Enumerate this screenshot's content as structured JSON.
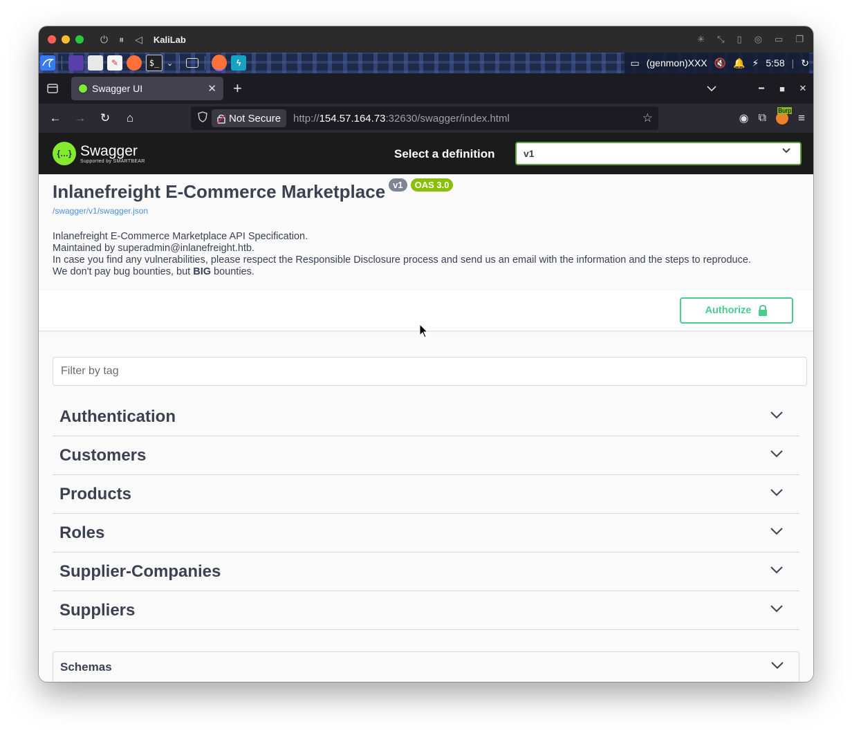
{
  "vm_window": {
    "title": "KaliLab"
  },
  "panel": {
    "plugin_label": "(genmon)XXX",
    "clock": "5:58"
  },
  "browser": {
    "tab": {
      "title": "Swagger UI",
      "close": "✕"
    },
    "new_tab": "+",
    "security_label": "Not Secure",
    "url_prefix": "http://",
    "url_host": "154.57.164.73",
    "url_rest": ":32630/swagger/index.html",
    "extension_badge": "Burp"
  },
  "swagger": {
    "logo_name": "Swagger",
    "logo_sub": "Supported by SMARTBEAR",
    "logo_glyph": "{…}",
    "definition_label": "Select a definition",
    "definition_value": "v1",
    "title": "Inlanefreight E-Commerce Marketplace",
    "version_badge": "v1",
    "oas_badge": "OAS 3.0",
    "spec_link": "/swagger/v1/swagger.json",
    "description": {
      "line1": "Inlanefreight E-Commerce Marketplace API Specification.",
      "line2": "Maintained by superadmin@inlanefreight.htb.",
      "line3": "In case you find any vulnerabilities, please respect the Responsible Disclosure process and send us an email with the information and the steps to reproduce.",
      "line4_pre": "We don't pay bug bounties, but ",
      "line4_bold": "BIG",
      "line4_post": " bounties."
    },
    "authorize_label": "Authorize",
    "filter_placeholder": "Filter by tag",
    "tags": [
      "Authentication",
      "Customers",
      "Products",
      "Roles",
      "Supplier-Companies",
      "Suppliers"
    ],
    "schemas_label": "Schemas"
  },
  "colors": {
    "accent_green": "#49cc90",
    "swagger_topbar": "#1b1b1b",
    "text": "#3b4151",
    "link": "#4990e2",
    "oas_badge": "#89bf04",
    "version_badge": "#7d8492"
  }
}
